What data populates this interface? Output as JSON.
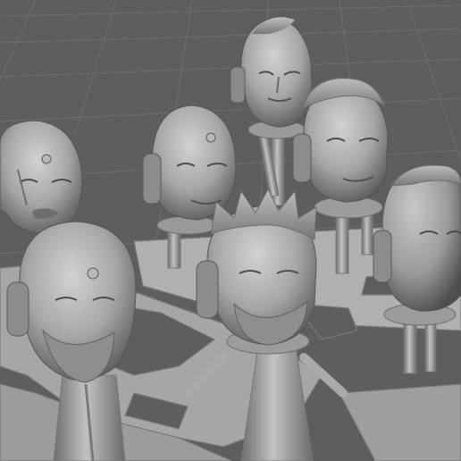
{
  "viewport": {
    "kind": "3d-model-preview",
    "background_color": "#5e5e5e",
    "grid_line_color": "#6c6c6c",
    "model_material_color": "#a8a8a8",
    "grid_visible": true
  },
  "scene": {
    "models": [
      {
        "name": "head-bald-third-eye-left"
      },
      {
        "name": "head-mohawk-headset-back"
      },
      {
        "name": "head-bald-headset-center"
      },
      {
        "name": "head-swept-hair-headset"
      },
      {
        "name": "head-bald-bearded-front"
      },
      {
        "name": "head-spiky-hair-bearded-front"
      },
      {
        "name": "head-mohawk-headset-right"
      }
    ],
    "support_structure": {
      "name": "print-sprue-supports"
    }
  }
}
